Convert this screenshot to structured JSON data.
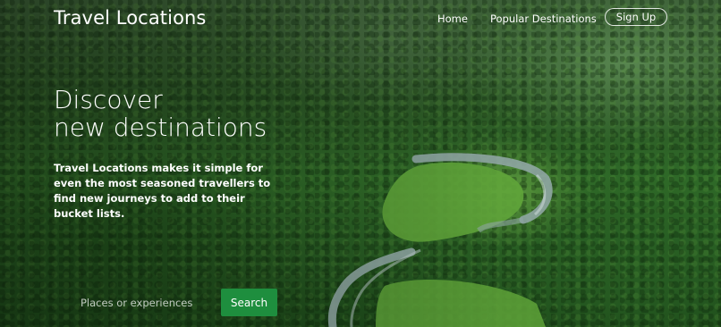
{
  "header": {
    "brand": "Travel Locations",
    "nav": {
      "home": "Home",
      "popular": "Popular Destinations"
    },
    "signup_label": "Sign Up"
  },
  "hero": {
    "headline_line1": "Discover",
    "headline_line2": "new destinations",
    "lead": "Travel Locations makes it simple for even the most seasoned travellers to find new journeys to add to their bucket lists."
  },
  "search": {
    "placeholder": "Places or experiences",
    "value": "",
    "button_label": "Search"
  },
  "colors": {
    "accent": "#1e8e3e",
    "text": "#ffffff"
  }
}
